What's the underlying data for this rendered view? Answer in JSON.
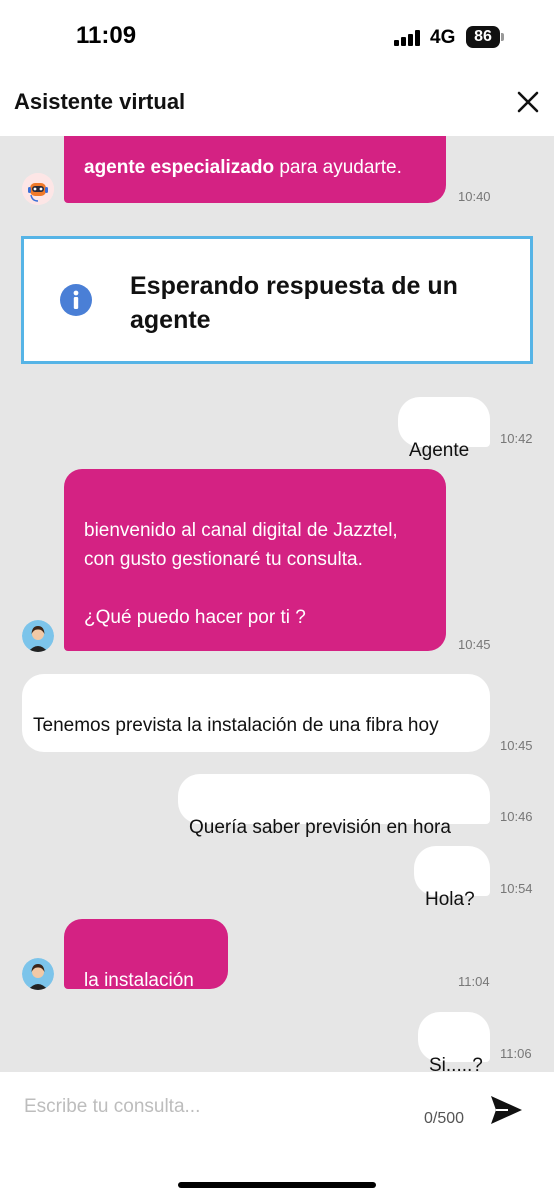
{
  "status_bar": {
    "time": "11:09",
    "network": "4G",
    "battery": "86"
  },
  "header": {
    "title": "Asistente virtual"
  },
  "info_banner": {
    "text": "Esperando respuesta de un agente"
  },
  "messages": [
    {
      "from": "agent",
      "bold": "agente especializado",
      "text": " para ayudarte.",
      "time": "10:40"
    },
    {
      "from": "user",
      "text": "Agente",
      "time": "10:42"
    },
    {
      "from": "agent",
      "text": "bienvenido al canal digital de Jazztel, con gusto gestionaré tu consulta.\n\n¿Qué puedo hacer por ti ?",
      "time": "10:45"
    },
    {
      "from": "user",
      "text": "Tenemos prevista la instalación de una fibra hoy",
      "time": "10:45"
    },
    {
      "from": "user",
      "text": "Quería saber previsión en hora",
      "time": "10:46"
    },
    {
      "from": "user",
      "text": "Hola?",
      "time": "10:54"
    },
    {
      "from": "agent",
      "text": "la instalación",
      "time": "11:04"
    },
    {
      "from": "user",
      "text": "Si.....?",
      "time": "11:06"
    }
  ],
  "composer": {
    "placeholder": "Escribe tu consulta...",
    "counter": "0/500"
  },
  "icons": {
    "close": "close-icon",
    "info": "info-icon",
    "send": "send-icon",
    "bot": "robot-avatar-icon",
    "agent": "agent-avatar-icon"
  },
  "colors": {
    "agent_bubble": "#d42283",
    "info_border": "#56b4e6",
    "info_icon": "#4a7fd6"
  }
}
